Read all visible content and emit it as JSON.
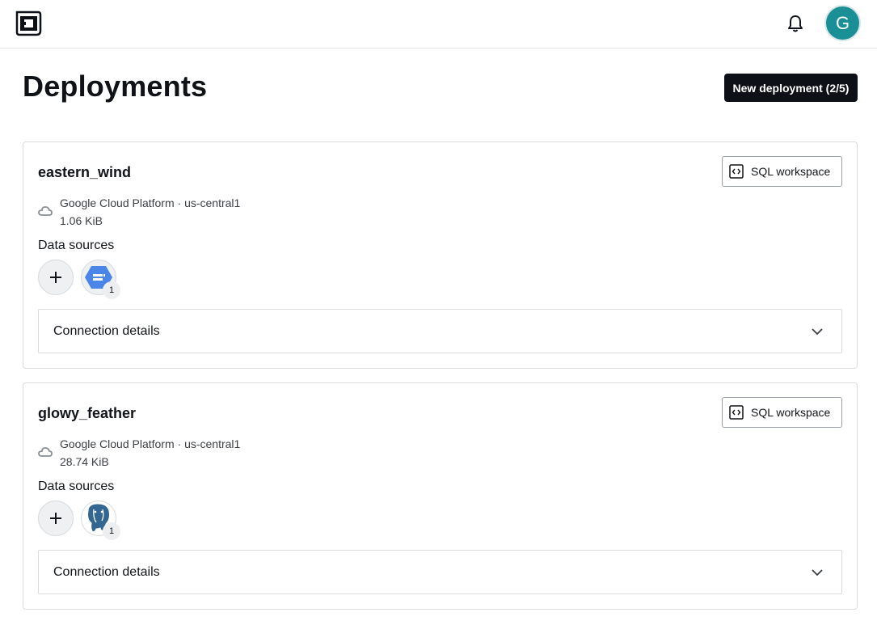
{
  "header": {
    "logo_icon": "app-logo-icon",
    "notifications_icon": "bell-icon",
    "avatar_initial": "G",
    "avatar_color": "#1a8f96"
  },
  "main": {
    "title": "Deployments",
    "new_deployment_label": "New deployment (2/5)"
  },
  "deployments": [
    {
      "name": "eastern_wind",
      "sql_workspace_label": "SQL workspace",
      "provider": "Google Cloud Platform · us-central1",
      "size": "1.06 KiB",
      "data_sources_label": "Data sources",
      "data_source_icon": "bigquery-icon",
      "data_source_count": "1",
      "connection_details_label": "Connection details"
    },
    {
      "name": "glowy_feather",
      "sql_workspace_label": "SQL workspace",
      "provider": "Google Cloud Platform · us-central1",
      "size": "28.74 KiB",
      "data_sources_label": "Data sources",
      "data_source_icon": "postgresql-icon",
      "data_source_count": "1",
      "connection_details_label": "Connection details"
    }
  ]
}
